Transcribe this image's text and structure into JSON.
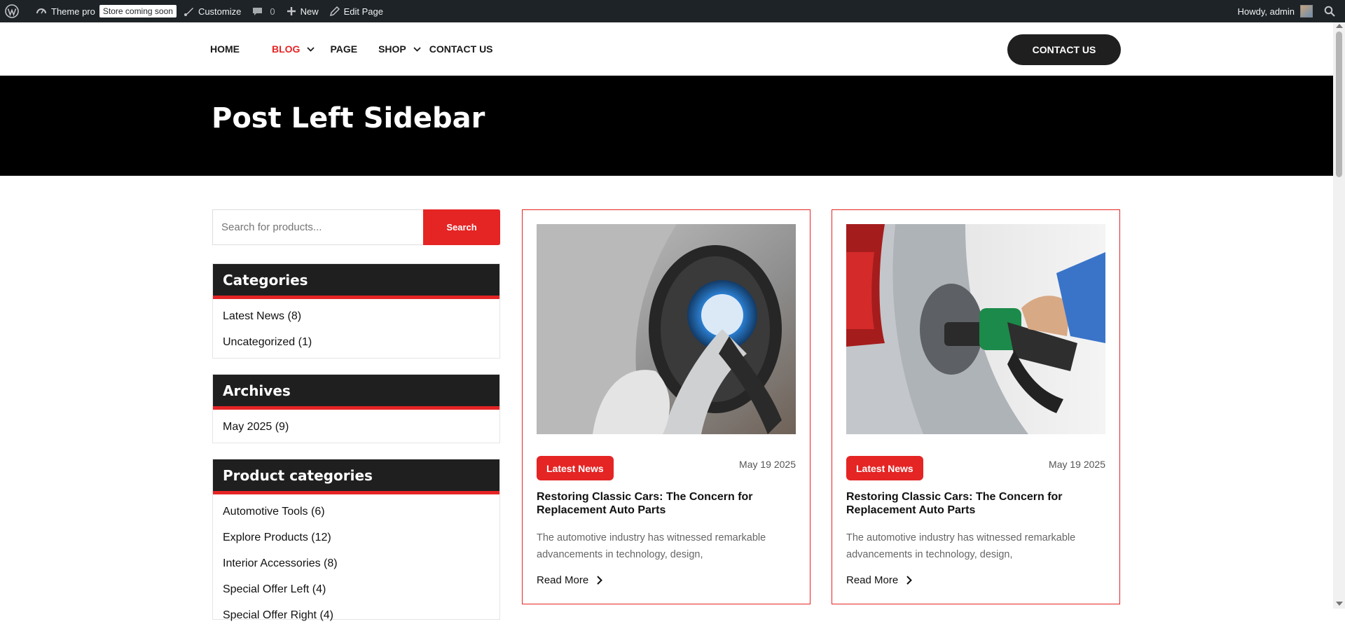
{
  "adminbar": {
    "site_name": "Theme pro",
    "badge": "Store coming soon",
    "customize": "Customize",
    "comments_count": "0",
    "new": "New",
    "edit_page": "Edit Page",
    "howdy": "Howdy, admin"
  },
  "nav": {
    "items": [
      {
        "label": "HOME"
      },
      {
        "label": "BLOG"
      },
      {
        "label": "PAGE"
      },
      {
        "label": "SHOP"
      },
      {
        "label": "CONTACT US"
      }
    ],
    "cta": "CONTACT US",
    "accent": "#e52424"
  },
  "hero": {
    "title": "Post Left Sidebar"
  },
  "sidebar": {
    "search_placeholder": "Search for products...",
    "search_button": "Search",
    "widgets": [
      {
        "title": "Categories",
        "items": [
          "Latest News (8)",
          "Uncategorized (1)"
        ]
      },
      {
        "title": "Archives",
        "items": [
          "May 2025 (9)"
        ]
      },
      {
        "title": "Product categories",
        "items": [
          "Automotive Tools (6)",
          "Explore Products (12)",
          "Interior Accessories (8)",
          "Special Offer Left (4)",
          "Special Offer Right (4)"
        ]
      }
    ]
  },
  "posts": [
    {
      "tag": "Latest News",
      "date": "May  19 2025",
      "title": "Restoring Classic Cars: The Concern for Replacement Auto Parts",
      "excerpt": "The automotive industry has witnessed remarkable advancements in technology, design,",
      "read_more": "Read More",
      "image": "electric-car-charging"
    },
    {
      "tag": "Latest News",
      "date": "May  19 2025",
      "title": "Restoring Classic Cars: The Concern for Replacement Auto Parts",
      "excerpt": "The automotive industry has witnessed remarkable advancements in technology, design,",
      "read_more": "Read More",
      "image": "car-refueling"
    }
  ]
}
